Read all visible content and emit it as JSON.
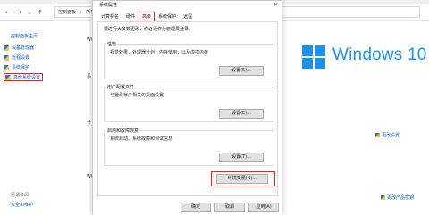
{
  "address": {
    "crumbs": [
      "控制面板",
      "›",
      "所有控制面板项",
      "›",
      "系统"
    ]
  },
  "sidebar": {
    "home": "控制面板主页",
    "items": [
      {
        "label": "设备管理器"
      },
      {
        "label": "远程设置"
      },
      {
        "label": "系统保护"
      },
      {
        "label": "高级系统设置"
      }
    ],
    "see_also": "另请参阅",
    "security": "安全和维护"
  },
  "background": {
    "frag1": "Wi",
    "frag2": "系",
    "frag3": "计",
    "frag4": "Wi",
    "change_settings": "更改设置",
    "change_product_key": "更改产品密钥",
    "windows_text": "Windows 10",
    "accent": "#1e90e6"
  },
  "dialog": {
    "title": "系统属性",
    "close": "✕",
    "tabs": [
      "计算机名",
      "硬件",
      "高级",
      "系统保护",
      "远程"
    ],
    "note": "要进行大多数更改，你必须作为管理员登录。",
    "performance": {
      "label": "性能",
      "desc": "视觉效果，处理器计划，内存使用，以及虚拟内存",
      "button": "设置(S)..."
    },
    "profiles": {
      "label": "用户配置文件",
      "desc": "与登录帐户相关的桌面设置",
      "button": "设置(E)..."
    },
    "startup": {
      "label": "启动和故障恢复",
      "desc": "系统启动、系统故障和调试信息",
      "button": "设置(T)..."
    },
    "env_button": "环境变量(N)...",
    "ok": "确定",
    "cancel": "取消",
    "apply": "应用(A)"
  },
  "highlight_color": "#d7262b"
}
